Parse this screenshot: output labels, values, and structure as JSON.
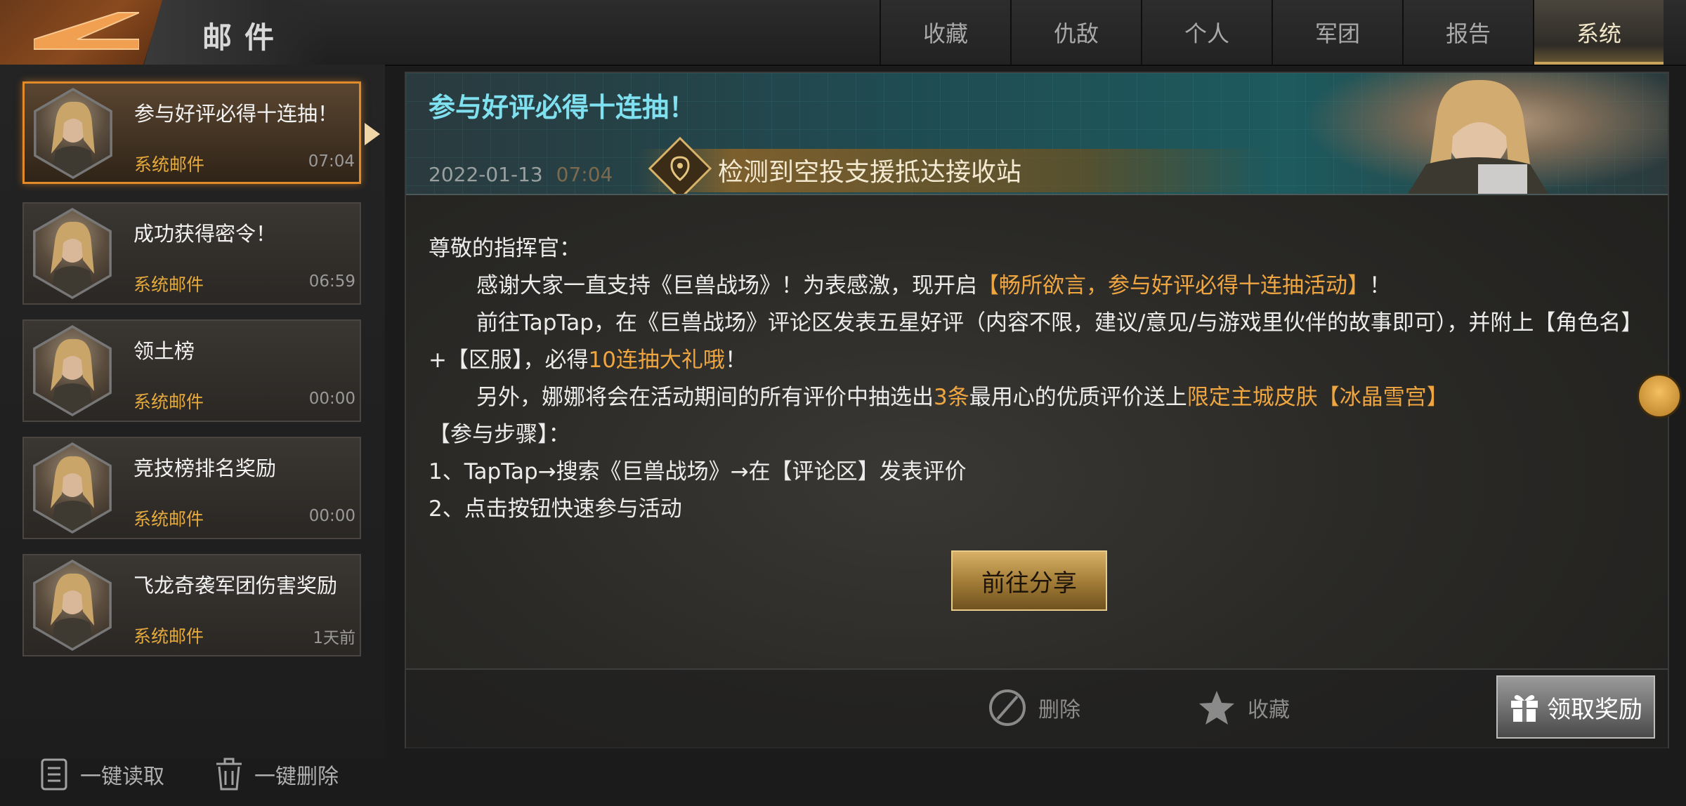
{
  "header": {
    "title": "邮件",
    "tabs": [
      {
        "label": "收藏",
        "active": false
      },
      {
        "label": "仇敌",
        "active": false
      },
      {
        "label": "个人",
        "active": false
      },
      {
        "label": "军团",
        "active": false
      },
      {
        "label": "报告",
        "active": false
      },
      {
        "label": "系统",
        "active": true
      }
    ]
  },
  "mail_list": [
    {
      "subject": "参与好评必得十连抽！",
      "sender": "系统邮件",
      "time": "07:04",
      "selected": true
    },
    {
      "subject": "成功获得密令！",
      "sender": "系统邮件",
      "time": "06:59",
      "selected": false
    },
    {
      "subject": "领土榜",
      "sender": "系统邮件",
      "time": "00:00",
      "selected": false
    },
    {
      "subject": "竞技榜排名奖励",
      "sender": "系统邮件",
      "time": "00:00",
      "selected": false
    },
    {
      "subject": "飞龙奇袭军团伤害奖励",
      "sender": "系统邮件",
      "time": "1天前",
      "selected": false
    }
  ],
  "bulk_actions": {
    "read_all": "一键读取",
    "delete_all": "一键删除"
  },
  "mail_detail": {
    "title": "参与好评必得十连抽！",
    "date": "2022-01-13",
    "time": "07:04",
    "ribbon_text": "检测到空投支援抵达接收站",
    "greeting": "尊敬的指挥官：",
    "p1_a": "感谢大家一直支持《巨兽战场》！为表感激，现开启",
    "p1_hl": "【畅所欲言，参与好评必得十连抽活动】",
    "p1_b": "！",
    "p2_a": "前往TapTap，在《巨兽战场》评论区发表五星好评（内容不限，建议/意见/与游戏里伙伴的故事即可），并附上【角色名】+【区服】，必得",
    "p2_hl": "10连抽大礼哦",
    "p2_b": "！",
    "p3_a": "另外，娜娜将会在活动期间的所有评价中抽选出",
    "p3_hl1": "3条",
    "p3_b": "最用心的优质评价送上",
    "p3_hl2": "限定主城皮肤【冰晶雪宫】",
    "steps_title": "【参与步骤】：",
    "step1": "1、TapTap→搜索《巨兽战场》→在【评论区】发表评价",
    "step2": "2、点击按钮快速参与活动",
    "share_button": "前往分享"
  },
  "footer": {
    "delete": "删除",
    "favorite": "收藏",
    "claim": "领取奖励"
  },
  "colors": {
    "highlight": "#f0a640",
    "banner_title": "#7fe0f0",
    "sender": "#e6a93c",
    "selected_border": "#e08a2a"
  }
}
